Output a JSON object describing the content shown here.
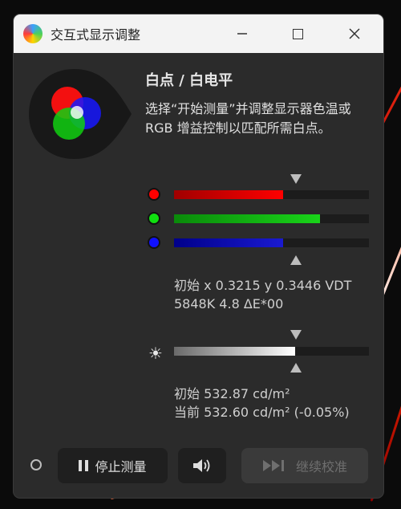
{
  "window": {
    "title": "交互式显示调整"
  },
  "header": {
    "heading": "白点 / 白电平",
    "description": "选择“开始测量”并调整显示器色温或RGB 增益控制以匹配所需白点。"
  },
  "rgb": {
    "channels": [
      {
        "name": "red",
        "color": "#ff0000",
        "dot_color": "#ff0000",
        "level": 0.56
      },
      {
        "name": "green",
        "color": "#19d419",
        "dot_color": "#10e010",
        "level": 0.75
      },
      {
        "name": "blue",
        "color": "#1a1ad0",
        "dot_color": "#1010ff",
        "level": 0.56
      }
    ],
    "target_level": 0.62,
    "readout_line1": "初始 x 0.3215 y 0.3446 VDT",
    "readout_line2": "5848K 4.8 ΔE*00"
  },
  "luminance": {
    "level": 0.62,
    "target_level": 0.62,
    "initial": "初始 532.87 cd/m²",
    "current": "当前 532.60 cd/m² (-0.05%)"
  },
  "buttons": {
    "stop_label": "停止测量",
    "continue_label": "继续校准"
  },
  "icons": {
    "app": "color-wheel-icon",
    "sun": "brightness-icon",
    "speaker": "speaker-icon",
    "status": "status-ring-icon"
  }
}
